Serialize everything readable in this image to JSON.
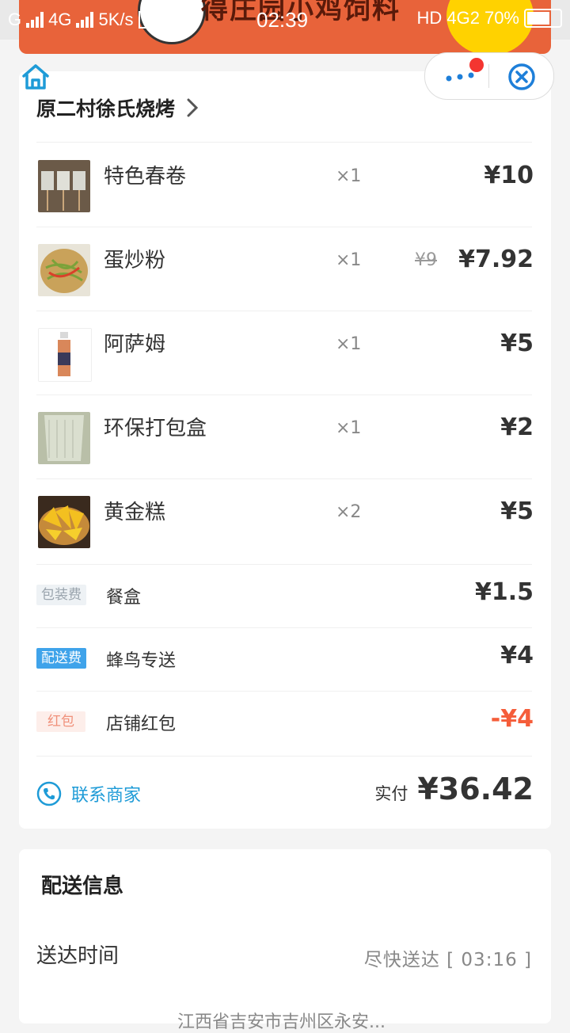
{
  "status_bar": {
    "carrier_left": "G",
    "network_left": "4G",
    "speed": "5K/s",
    "time": "02:39",
    "network_right": "HD 4G2",
    "battery": "70%"
  },
  "banner": {
    "text": "得庄园小鸡饲料"
  },
  "order": {
    "shop_name": "原二村徐氏烧烤",
    "items": [
      {
        "name": "特色春卷",
        "qty": "×1",
        "original_price": "",
        "price": "¥10"
      },
      {
        "name": "蛋炒粉",
        "qty": "×1",
        "original_price": "¥9",
        "price": "¥7.92"
      },
      {
        "name": "阿萨姆",
        "qty": "×1",
        "original_price": "",
        "price": "¥5"
      },
      {
        "name": "环保打包盒",
        "qty": "×1",
        "original_price": "",
        "price": "¥2"
      },
      {
        "name": "黄金糕",
        "qty": "×2",
        "original_price": "",
        "price": "¥5"
      }
    ],
    "fees": [
      {
        "tag": "包装费",
        "label": "餐盒",
        "price": "¥1.5"
      },
      {
        "tag": "配送费",
        "label": "蜂鸟专送",
        "price": "¥4"
      },
      {
        "tag": "红包",
        "label": "店铺红包",
        "price": "-¥4"
      }
    ],
    "contact_label": "联系商家",
    "total_label": "实付",
    "total_value": "¥36.42"
  },
  "delivery": {
    "title": "配送信息",
    "time_label": "送达时间",
    "time_value": "尽快送达 [ 03:16 ]",
    "address_partial": "江西省吉安市吉州区永安..."
  },
  "colors": {
    "accent_blue": "#1e9bd7",
    "discount_red": "#f55d3a"
  }
}
